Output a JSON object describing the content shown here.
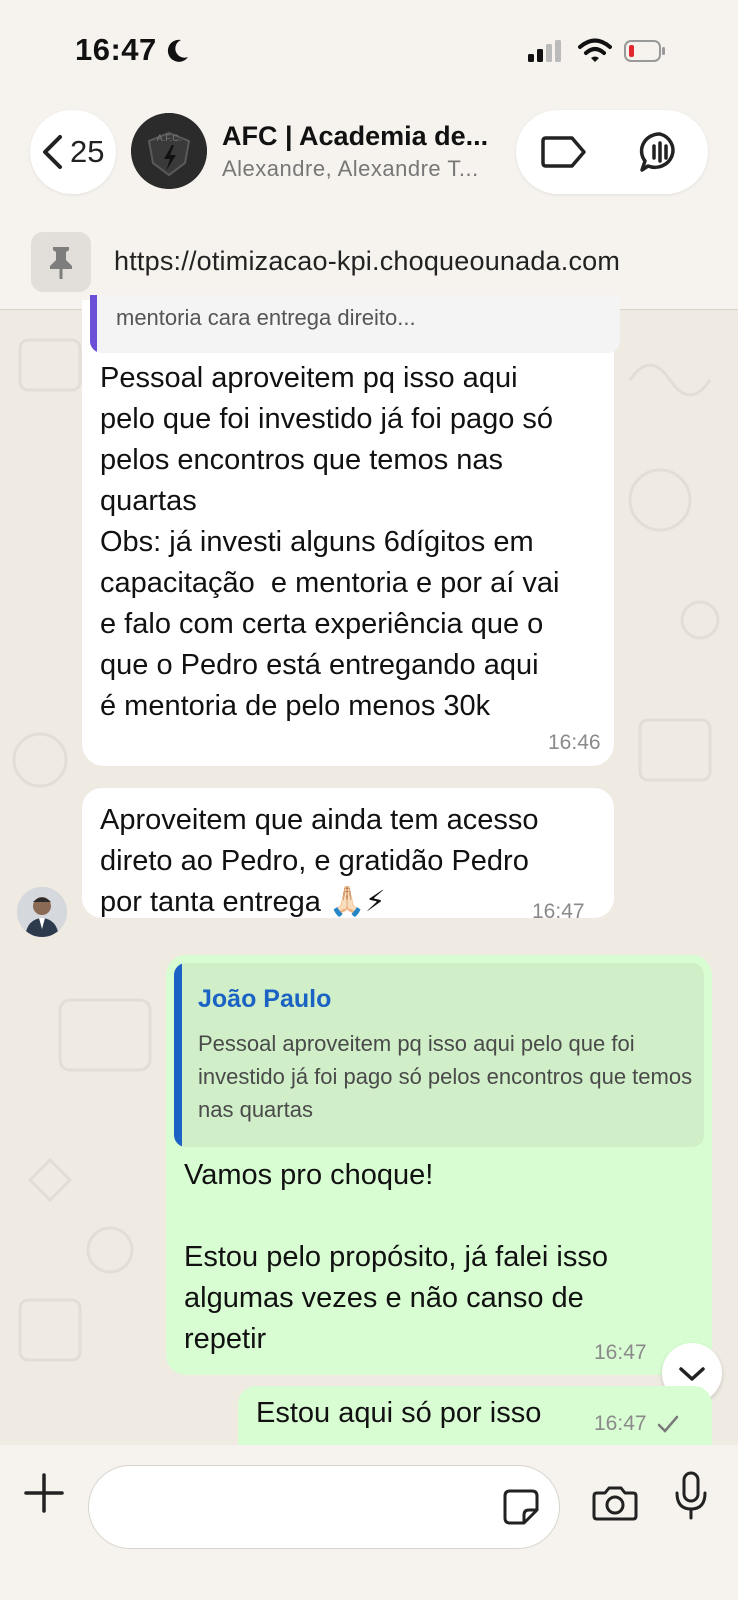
{
  "status_bar": {
    "time": "16:47",
    "icons": [
      "moon-icon",
      "cellular-signal-icon",
      "wifi-icon",
      "battery-low-icon"
    ]
  },
  "header": {
    "back_count": "25",
    "group_name": "AFC | Academia de...",
    "members": "Alexandre, Alexandre T...",
    "avatar_text": "A.F.C.",
    "icons": [
      "back-chevron-icon",
      "label-icon",
      "group-call-icon"
    ]
  },
  "pinned": {
    "url": "https://otimizacao-kpi.choqueounada.com",
    "icon": "pin-icon"
  },
  "messages": [
    {
      "direction": "incoming",
      "quoted_text": "mentoria cara entrega direito...",
      "text": "Pessoal aproveitem pq isso aqui\npelo que foi investido já foi pago só\npelos encontros que temos nas\nquartas\nObs: já investi alguns 6dígitos em\ncapacitação  e mentoria e por aí vai\ne falo com certa experiência que o\nque o Pedro está entregando aqui\né mentoria de pelo menos 30k",
      "time": "16:46"
    },
    {
      "direction": "incoming",
      "text": "Aproveitem que ainda tem acesso\ndireto ao Pedro, e gratidão Pedro\npor tanta entrega 🙏🏻⚡",
      "time": "16:47"
    },
    {
      "direction": "outgoing",
      "quote_author": "João Paulo",
      "quoted_text": "Pessoal aproveitem pq isso aqui pelo que foi investido já foi pago só pelos encontros que temos nas quartas",
      "text": "Vamos pro choque!\n\nEstou pelo propósito, já falei isso\nalgumas vezes e não canso de\nrepetir",
      "time": "16:47"
    },
    {
      "direction": "outgoing",
      "text": "Estou aqui só por isso",
      "time": "16:47"
    }
  ],
  "composer": {
    "placeholder": "",
    "icons": [
      "plus-icon",
      "sticker-icon",
      "camera-icon",
      "microphone-icon"
    ]
  },
  "colors": {
    "incoming_bubble": "#ffffff",
    "outgoing_bubble": "#d9fdd3",
    "quote_accent": "#1a63c4",
    "background": "#efeae2"
  }
}
